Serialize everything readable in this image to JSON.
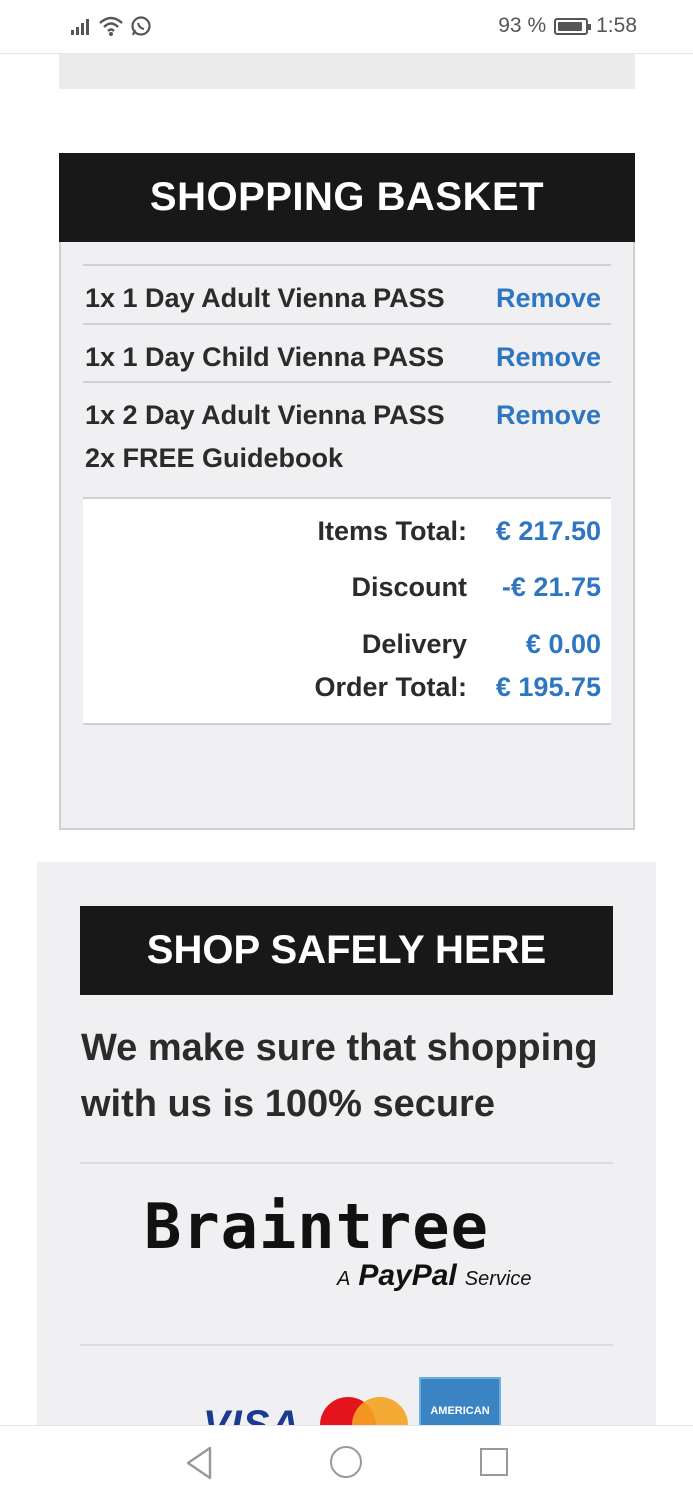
{
  "status_bar": {
    "battery_percent": "93 %",
    "time": "1:58",
    "icons": [
      "signal-icon",
      "wifi-icon",
      "whatsapp-icon",
      "battery-icon"
    ]
  },
  "basket": {
    "title": "SHOPPING BASKET",
    "items": [
      {
        "label": "1x 1 Day Adult Vienna PASS",
        "remove": "Remove"
      },
      {
        "label": "1x 1 Day Child Vienna PASS",
        "remove": "Remove"
      },
      {
        "label": "1x 2 Day Adult Vienna PASS",
        "remove": "Remove",
        "extra": "2x FREE Guidebook"
      }
    ],
    "totals": {
      "items_total_label": "Items Total:",
      "items_total_value": "€ 217.50",
      "discount_label": "Discount",
      "discount_value": "-€ 21.75",
      "delivery_label": "Delivery",
      "delivery_value": "€ 0.00",
      "order_total_label": "Order Total:",
      "order_total_value": "€ 195.75"
    }
  },
  "safe": {
    "title": "SHOP SAFELY HERE",
    "text": "We make sure that shopping with us is 100% secure",
    "braintree": "Braintree",
    "paypal_a": "A",
    "paypal": "PayPal",
    "paypal_service": "Service",
    "cards": {
      "visa": "VISA",
      "amex": "AMERICAN"
    }
  },
  "colors": {
    "accent": "#2f76c2",
    "header_bg": "#181818",
    "panel_bg": "#f0f0f2"
  }
}
